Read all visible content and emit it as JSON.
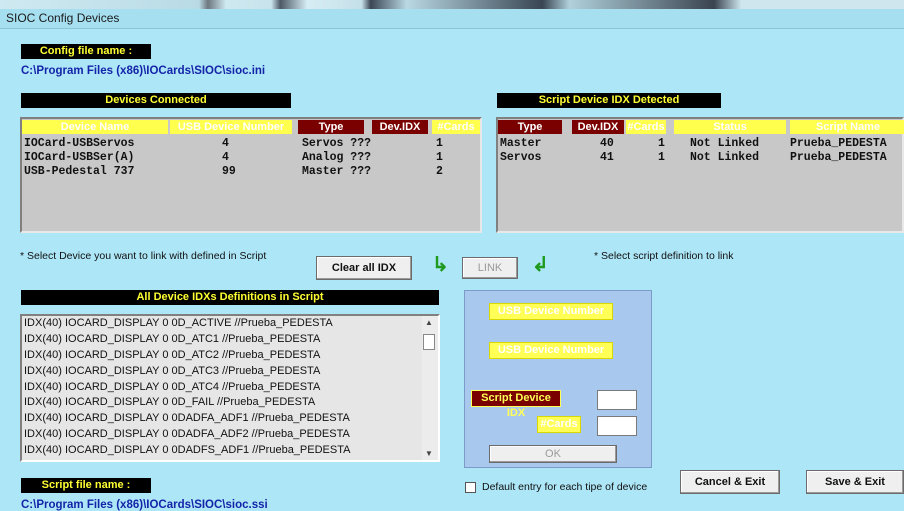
{
  "window": {
    "title": "SIOC Config Devices"
  },
  "config": {
    "label": "Config file name :",
    "path": "C:\\Program Files (x86)\\IOCards\\SIOC\\sioc.ini"
  },
  "devices": {
    "header": "Devices Connected",
    "columns": [
      "Device Name",
      "USB Device Number",
      "Type",
      "Dev.IDX",
      "#Cards"
    ],
    "rows": [
      {
        "name": "IOCard-USBServos",
        "usb": "4",
        "type": "Servos ???",
        "idx": "1"
      },
      {
        "name": "IOCard-USBSer(A)",
        "usb": "4",
        "type": "Analog ???",
        "idx": "1"
      },
      {
        "name": "USB-Pedestal 737",
        "usb": "99",
        "type": "Master ???",
        "idx": "2"
      }
    ]
  },
  "script_idx": {
    "header": "Script Device IDX Detected",
    "columns": [
      "Type",
      "Dev.IDX",
      "#Cards",
      "Status",
      "Script Name"
    ],
    "rows": [
      {
        "type": "Master",
        "idx": "40",
        "cards": "1",
        "status": "Not Linked",
        "script": "Prueba_PEDESTA"
      },
      {
        "type": "Servos",
        "idx": "41",
        "cards": "1",
        "status": "Not Linked",
        "script": "Prueba_PEDESTA"
      }
    ]
  },
  "notes": {
    "select_device": "* Select Device  you want to link with defined in Script",
    "select_script": "* Select script definition to link"
  },
  "buttons": {
    "clear": "Clear all IDX",
    "link": "LINK",
    "ok": "OK",
    "cancel": "Cancel & Exit",
    "save": "Save & Exit"
  },
  "definitions": {
    "header": "All Device IDXs Definitions in Script",
    "items": [
      "IDX(40) IOCARD_DISPLAY 0 0D_ACTIVE //Prueba_PEDESTA",
      "IDX(40) IOCARD_DISPLAY 0 0D_ATC1 //Prueba_PEDESTA",
      "IDX(40) IOCARD_DISPLAY 0 0D_ATC2 //Prueba_PEDESTA",
      "IDX(40) IOCARD_DISPLAY 0 0D_ATC3 //Prueba_PEDESTA",
      "IDX(40) IOCARD_DISPLAY 0 0D_ATC4 //Prueba_PEDESTA",
      "IDX(40) IOCARD_DISPLAY 0 0D_FAIL //Prueba_PEDESTA",
      "IDX(40) IOCARD_DISPLAY 0 0DADFA_ADF1 //Prueba_PEDESTA",
      "IDX(40) IOCARD_DISPLAY 0 0DADFA_ADF2 //Prueba_PEDESTA",
      "IDX(40) IOCARD_DISPLAY 0 0DADFS_ADF1 //Prueba_PEDESTA"
    ]
  },
  "link_panel": {
    "usb1": "USB Device Number",
    "usb2": "USB Device Number",
    "script_idx": "Script Device IDX",
    "cards": "#Cards"
  },
  "checkbox": {
    "label": "Default entry for each tipe of device"
  },
  "script_file": {
    "label": "Script file name :",
    "path": "C:\\Program Files (x86)\\IOCards\\SIOC\\sioc.ssi"
  },
  "icons": [
    "arrow-down-right-icon",
    "arrow-down-left-icon",
    "scroll-up-icon",
    "scroll-down-icon"
  ],
  "colors": {
    "background": "#ade6f7",
    "header_bg": "#000000",
    "header_text": "#ffff33",
    "accent_red": "#7a0000",
    "accent_yellow": "#ffff4d",
    "path_blue": "#1424a8"
  }
}
